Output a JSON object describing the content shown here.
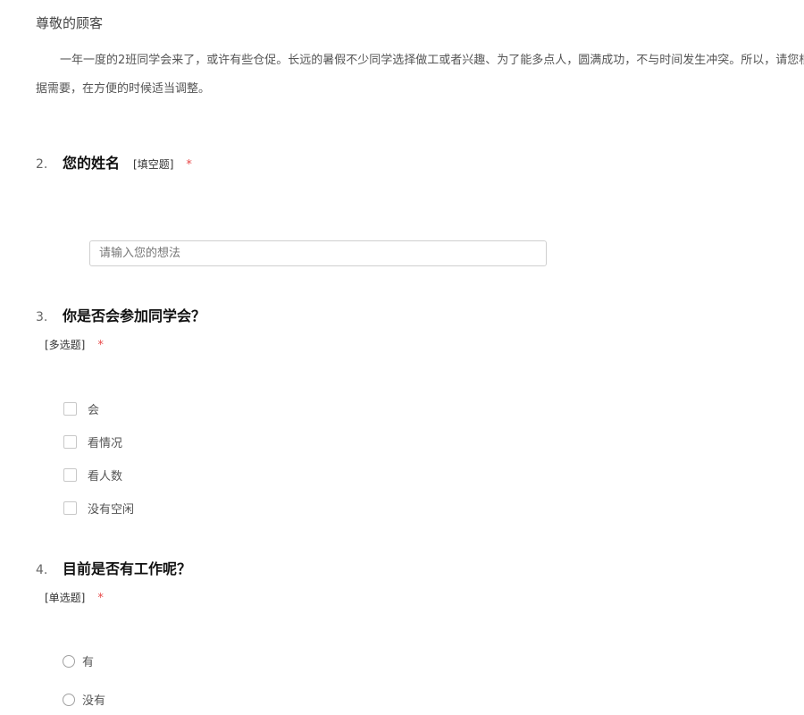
{
  "greeting": "尊敬的顾客",
  "intro": "一年一度的2班同学会来了，或许有些仓促。长远的暑假不少同学选择做工或者兴趣、为了能多点人，圆满成功，不与时间发生冲突。所以，请您根据需要，在方便的时候适当调整。",
  "questions": [
    {
      "number": "2.",
      "title": "您的姓名",
      "type": "[填空题]",
      "required": "*",
      "placeholder": "请输入您的想法"
    },
    {
      "number": "3.",
      "title": "你是否会参加同学会？",
      "type": "[多选题]",
      "required": "*",
      "options": [
        "会",
        "看情况",
        "看人数",
        "没有空闲"
      ]
    },
    {
      "number": "4.",
      "title": "目前是否有工作呢？",
      "type": "[单选题]",
      "required": "*",
      "options": [
        "有",
        "没有"
      ]
    }
  ]
}
